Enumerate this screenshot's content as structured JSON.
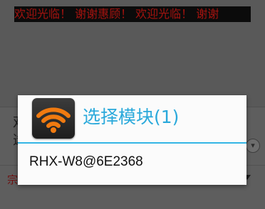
{
  "background": {
    "ticker_text": "欢迎光临！ 谢谢惠顾！ 欢迎光临！ 谢谢",
    "label_line1": "双",
    "label_line2": "选",
    "row_label": "宗"
  },
  "dialog": {
    "title": "选择模块(1)",
    "icon": "wifi-icon",
    "items": [
      {
        "label": "RHX-W8@6E2368"
      }
    ]
  },
  "colors": {
    "title": "#2aa9db",
    "divider": "#33b5e5",
    "icon_orange": "#f07a10"
  }
}
